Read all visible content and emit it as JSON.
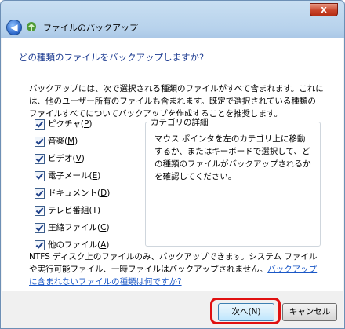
{
  "window": {
    "title": "ファイルのバックアップ",
    "close_label": "x"
  },
  "main": {
    "heading": "どの種類のファイルをバックアップしますか?",
    "intro": "バックアップには、次で選択される種類のファイルがすべて含まれます。これには、他のユーザー所有のファイルも含まれます。既定で選択されている種類のファイルすべてについてバックアップを作成することを推奨します。",
    "checkboxes": [
      {
        "label": "ピクチャ(",
        "key": "P",
        "end": ")",
        "checked": true
      },
      {
        "label": "音楽(",
        "key": "M",
        "end": ")",
        "checked": true
      },
      {
        "label": "ビデオ(",
        "key": "V",
        "end": ")",
        "checked": true
      },
      {
        "label": "電子メール(",
        "key": "E",
        "end": ")",
        "checked": true
      },
      {
        "label": "ドキュメント(",
        "key": "D",
        "end": ")",
        "checked": true
      },
      {
        "label": "テレビ番組(",
        "key": "T",
        "end": ")",
        "checked": true
      },
      {
        "label": "圧縮ファイル(",
        "key": "C",
        "end": ")",
        "checked": true
      },
      {
        "label": "他のファイル(",
        "key": "A",
        "end": ")",
        "checked": true
      }
    ],
    "details": {
      "title": "カテゴリの詳細",
      "body": "マウス ポインタを左のカテゴリ上に移動するか、またはキーボードで選択して、どの種類のファイルがバックアップされるかを確認してください。"
    },
    "note": "NTFS ディスク上のファイルのみ、バックアップできます。システム ファイルや実行可能ファイル、一時ファイルはバックアップされません。",
    "note_link": "バックアップに含まれないファイルの種類は何ですか?"
  },
  "footer": {
    "next_label": "次へ(N)",
    "cancel_label": "キャンセル"
  },
  "colors": {
    "heading": "#1c3b91",
    "link": "#1a57c6",
    "highlight": "#e01010"
  }
}
